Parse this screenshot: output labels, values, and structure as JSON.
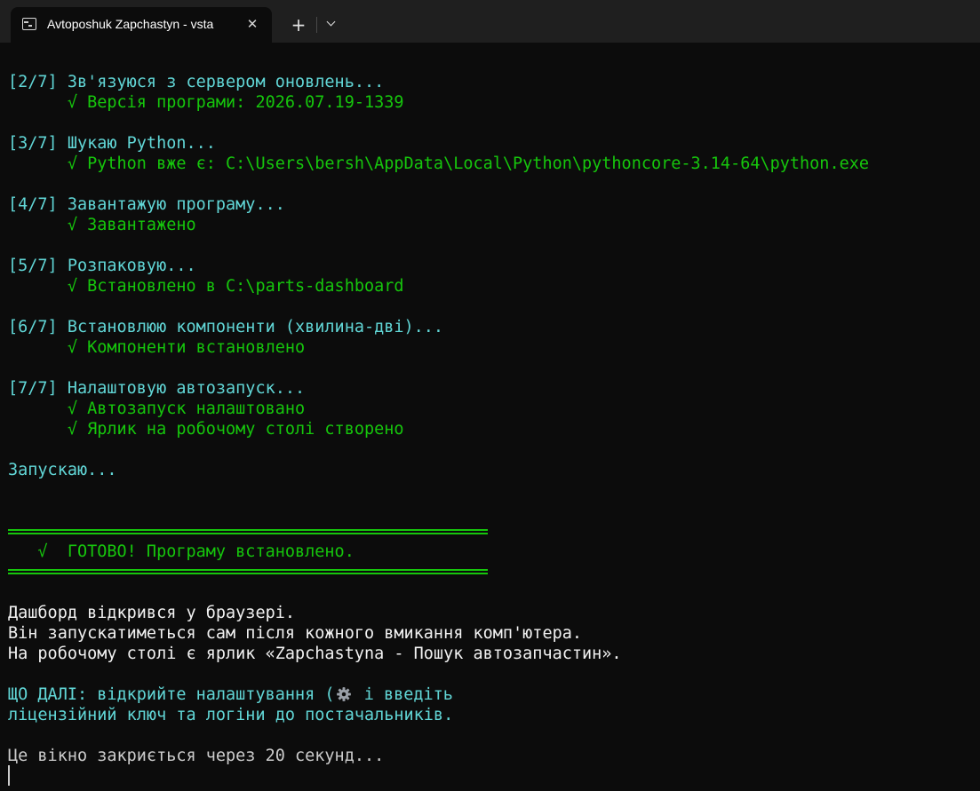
{
  "window": {
    "tab_title": "Avtoposhuk Zapchastyn - vsta",
    "tab_icon": "terminal-icon",
    "close_icon": "close-icon",
    "new_tab_icon": "plus-icon",
    "dropdown_icon": "chevron-down-icon"
  },
  "colors": {
    "background": "#0c0c0c",
    "titlebar": "#1f1f1f",
    "cyan": "#61d6d6",
    "green": "#16c60c",
    "white": "#f2f2f2",
    "gray": "#cccccc"
  },
  "terminal": {
    "steps": [
      {
        "header": "[2/7] Зв'язуюся з сервером оновлень...",
        "results": [
          "      √ Версія програми: 2026.07.19-1339"
        ]
      },
      {
        "header": "[3/7] Шукаю Python...",
        "results": [
          "      √ Python вже є: C:\\Users\\bersh\\AppData\\Local\\Python\\pythoncore-3.14-64\\python.exe"
        ]
      },
      {
        "header": "[4/7] Завантажую програму...",
        "results": [
          "      √ Завантажено"
        ]
      },
      {
        "header": "[5/7] Розпаковую...",
        "results": [
          "      √ Встановлено в C:\\parts-dashboard"
        ]
      },
      {
        "header": "[6/7] Встановлюю компоненти (хвилина-дві)...",
        "results": [
          "      √ Компоненти встановлено"
        ]
      },
      {
        "header": "[7/7] Налаштовую автозапуск...",
        "results": [
          "      √ Автозапуск налаштовано",
          "      √ Ярлик на робочому столі створено"
        ]
      }
    ],
    "launching": "Запускаю...",
    "banner": "   √  ГОТОВО! Програму встановлено.",
    "info_lines": [
      "Дашборд відкрився у браузері.",
      "Він запускатиметься сам після кожного вмикання комп'ютера.",
      "На робочому столі є ярлик «Zapchastyna - Пошук автозапчастин»."
    ],
    "next_line1_before": "ЩО ДАЛІ: відкрийте налаштування (",
    "next_line1_icon": "gear-icon",
    "next_line1_after": " і введіть",
    "next_line2": "ліцензійний ключ та логіни до постачальників.",
    "closing": "Це вікно закриється через 20 секунд..."
  }
}
